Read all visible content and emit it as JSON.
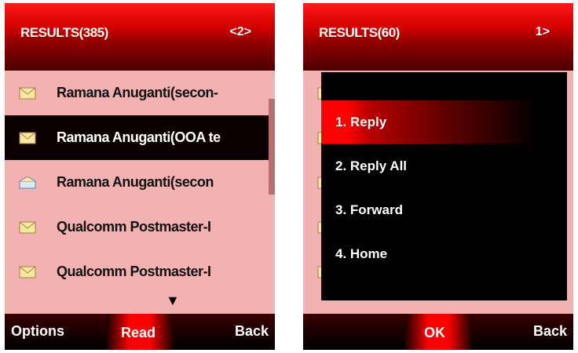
{
  "left_screen": {
    "header": {
      "title": "RESULTS(385)",
      "page": "<2>"
    },
    "items": [
      {
        "label": "Ramana Anuganti(secon-",
        "icon": "envelope-closed-icon",
        "selected": false
      },
      {
        "label": "Ramana Anuganti(OOA te",
        "icon": "envelope-closed-icon",
        "selected": true
      },
      {
        "label": "Ramana Anuganti(secon",
        "icon": "envelope-open-icon",
        "selected": false
      },
      {
        "label": "Qualcomm Postmaster-I",
        "icon": "envelope-closed-icon",
        "selected": false
      },
      {
        "label": "Qualcomm Postmaster-I",
        "icon": "envelope-closed-icon",
        "selected": false
      }
    ],
    "more_indicator": "▼",
    "softkeys": {
      "left": "Options",
      "center": "Read",
      "right": "Back"
    }
  },
  "right_screen": {
    "header": {
      "title": "RESULTS(60)",
      "page": "1>"
    },
    "menu": [
      {
        "label": "1. Reply",
        "active": true
      },
      {
        "label": "2. Reply All",
        "active": false
      },
      {
        "label": "3. Forward",
        "active": false
      },
      {
        "label": "4. Home",
        "active": false
      }
    ],
    "softkeys": {
      "center": "OK",
      "right": "Back"
    }
  },
  "colors": {
    "accent_red": "#ff0000",
    "list_bg": "#f3b2b2",
    "selected_row": "#0a0000"
  }
}
